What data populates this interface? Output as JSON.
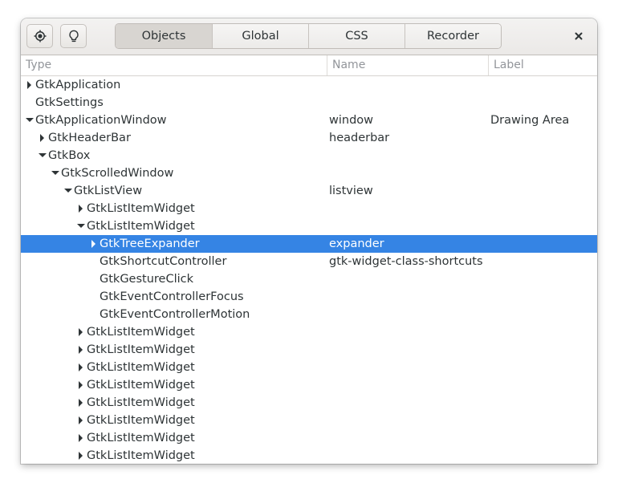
{
  "header": {
    "picker_icon": "crosshair-icon",
    "highlight_icon": "lightbulb-icon",
    "tabs": [
      {
        "label": "Objects",
        "active": true
      },
      {
        "label": "Global",
        "active": false
      },
      {
        "label": "CSS",
        "active": false
      },
      {
        "label": "Recorder",
        "active": false
      }
    ],
    "close_label": "×"
  },
  "columns": {
    "type": "Type",
    "name": "Name",
    "label": "Label"
  },
  "colors": {
    "selection": "#3584e4",
    "header_bg": "#ebe9e7",
    "text": "#2e3436",
    "column_header_text": "#92959a"
  },
  "rows": [
    {
      "type": "GtkApplication",
      "name": "",
      "label": "",
      "depth": 0,
      "expander": "collapsed",
      "selected": false
    },
    {
      "type": "GtkSettings",
      "name": "",
      "label": "",
      "depth": 0,
      "expander": "none",
      "selected": false
    },
    {
      "type": "GtkApplicationWindow",
      "name": "window",
      "label": "Drawing Area",
      "depth": 0,
      "expander": "expanded",
      "selected": false
    },
    {
      "type": "GtkHeaderBar",
      "name": "headerbar",
      "label": "",
      "depth": 1,
      "expander": "collapsed",
      "selected": false
    },
    {
      "type": "GtkBox",
      "name": "",
      "label": "",
      "depth": 1,
      "expander": "expanded",
      "selected": false
    },
    {
      "type": "GtkScrolledWindow",
      "name": "",
      "label": "",
      "depth": 2,
      "expander": "expanded",
      "selected": false
    },
    {
      "type": "GtkListView",
      "name": "listview",
      "label": "",
      "depth": 3,
      "expander": "expanded",
      "selected": false
    },
    {
      "type": "GtkListItemWidget",
      "name": "",
      "label": "",
      "depth": 4,
      "expander": "collapsed",
      "selected": false
    },
    {
      "type": "GtkListItemWidget",
      "name": "",
      "label": "",
      "depth": 4,
      "expander": "expanded",
      "selected": false
    },
    {
      "type": "GtkTreeExpander",
      "name": "expander",
      "label": "",
      "depth": 5,
      "expander": "collapsed",
      "selected": true
    },
    {
      "type": "GtkShortcutController",
      "name": "gtk-widget-class-shortcuts",
      "label": "",
      "depth": 5,
      "expander": "none",
      "selected": false
    },
    {
      "type": "GtkGestureClick",
      "name": "",
      "label": "",
      "depth": 5,
      "expander": "none",
      "selected": false
    },
    {
      "type": "GtkEventControllerFocus",
      "name": "",
      "label": "",
      "depth": 5,
      "expander": "none",
      "selected": false
    },
    {
      "type": "GtkEventControllerMotion",
      "name": "",
      "label": "",
      "depth": 5,
      "expander": "none",
      "selected": false
    },
    {
      "type": "GtkListItemWidget",
      "name": "",
      "label": "",
      "depth": 4,
      "expander": "collapsed",
      "selected": false
    },
    {
      "type": "GtkListItemWidget",
      "name": "",
      "label": "",
      "depth": 4,
      "expander": "collapsed",
      "selected": false
    },
    {
      "type": "GtkListItemWidget",
      "name": "",
      "label": "",
      "depth": 4,
      "expander": "collapsed",
      "selected": false
    },
    {
      "type": "GtkListItemWidget",
      "name": "",
      "label": "",
      "depth": 4,
      "expander": "collapsed",
      "selected": false
    },
    {
      "type": "GtkListItemWidget",
      "name": "",
      "label": "",
      "depth": 4,
      "expander": "collapsed",
      "selected": false
    },
    {
      "type": "GtkListItemWidget",
      "name": "",
      "label": "",
      "depth": 4,
      "expander": "collapsed",
      "selected": false
    },
    {
      "type": "GtkListItemWidget",
      "name": "",
      "label": "",
      "depth": 4,
      "expander": "collapsed",
      "selected": false
    },
    {
      "type": "GtkListItemWidget",
      "name": "",
      "label": "",
      "depth": 4,
      "expander": "collapsed",
      "selected": false
    }
  ]
}
